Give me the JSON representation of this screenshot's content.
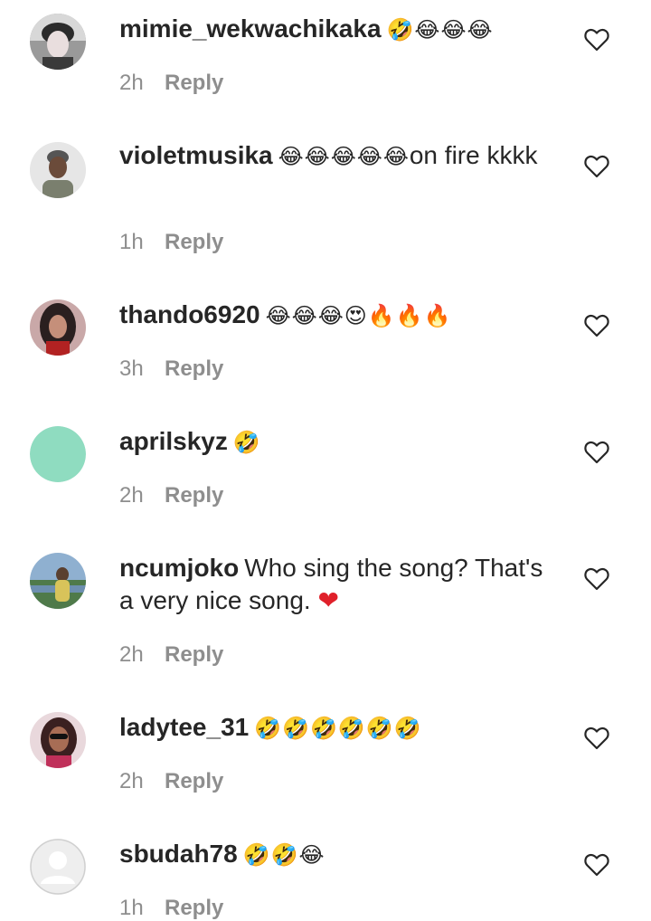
{
  "comments": [
    {
      "username": "mimie_wekwachikaka",
      "emojis": "🤣😂😂😂",
      "text": "",
      "text_after": "",
      "time": "2h",
      "reply_label": "Reply",
      "avatar": "photo-woman-headwrap"
    },
    {
      "username": "violetmusika",
      "emojis": "😂😂😂😂😂",
      "text": "on fire kkkk",
      "text_after": "",
      "time": "1h",
      "reply_label": "Reply",
      "avatar": "photo-person-headwrap"
    },
    {
      "username": "thando6920",
      "emojis": "😂😂😂😍🔥🔥🔥",
      "text": "",
      "text_after": "",
      "time": "3h",
      "reply_label": "Reply",
      "avatar": "photo-woman-long-hair"
    },
    {
      "username": "aprilskyz",
      "emojis": "🤣",
      "text": "",
      "text_after": "",
      "time": "2h",
      "reply_label": "Reply",
      "avatar": "solid-mint",
      "avatar_color": "#8fdcc0"
    },
    {
      "username": "ncumjoko",
      "emojis": "",
      "text": "Who sing the song? That's a very nice song.",
      "text_after": "❤",
      "time": "2h",
      "reply_label": "Reply",
      "avatar": "photo-outdoor-lake"
    },
    {
      "username": "ladytee_31",
      "emojis": "🤣🤣🤣🤣🤣🤣",
      "text": "",
      "text_after": "",
      "time": "2h",
      "reply_label": "Reply",
      "avatar": "photo-woman-sunglasses"
    },
    {
      "username": "sbudah78",
      "emojis": "🤣🤣😂",
      "text": "",
      "text_after": "",
      "time": "1h",
      "reply_label": "Reply",
      "avatar": "default-user-silhouette"
    }
  ],
  "icons": {
    "like": "heart-outline-icon"
  },
  "colors": {
    "text": "#262626",
    "meta": "#8e8e8e",
    "heart_red": "#e0202a"
  }
}
